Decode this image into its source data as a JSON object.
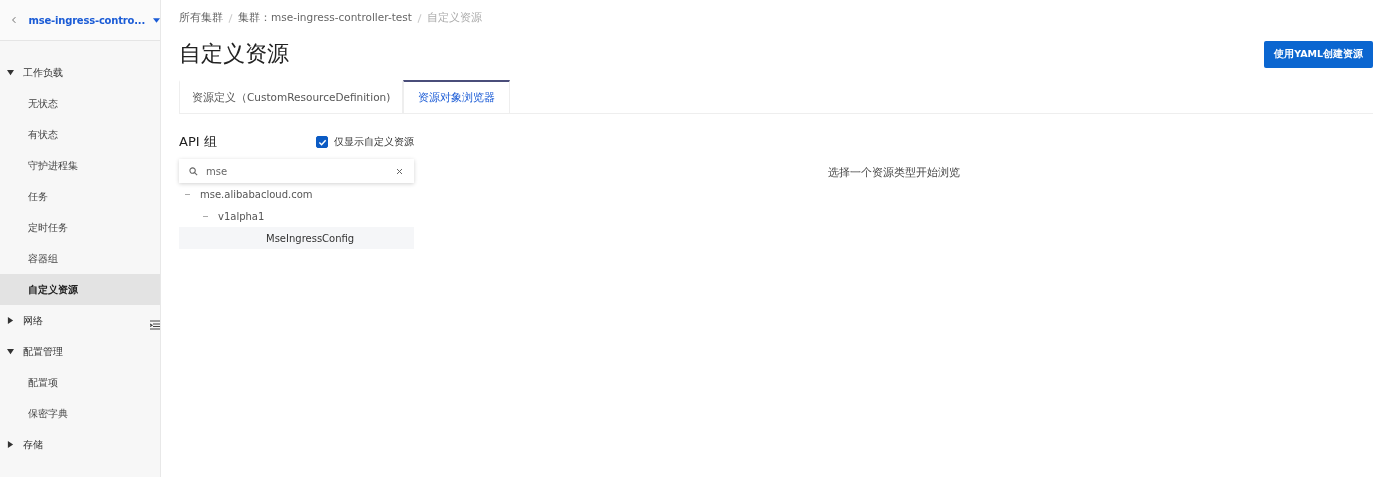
{
  "cluster_selector": {
    "label": "mse-ingress-contro..."
  },
  "sidebar": {
    "groups": [
      {
        "label": "工作负载",
        "expanded": true,
        "items": [
          {
            "label": "无状态",
            "selected": false
          },
          {
            "label": "有状态",
            "selected": false
          },
          {
            "label": "守护进程集",
            "selected": false
          },
          {
            "label": "任务",
            "selected": false
          },
          {
            "label": "定时任务",
            "selected": false
          },
          {
            "label": "容器组",
            "selected": false
          },
          {
            "label": "自定义资源",
            "selected": true
          }
        ]
      },
      {
        "label": "网络",
        "expanded": false
      },
      {
        "label": "配置管理",
        "expanded": true,
        "items": [
          {
            "label": "配置项",
            "selected": false
          },
          {
            "label": "保密字典",
            "selected": false
          }
        ]
      },
      {
        "label": "存储",
        "expanded": false
      }
    ]
  },
  "breadcrumb": [
    "所有集群",
    "集群：mse-ingress-controller-test",
    "自定义资源"
  ],
  "title": "自定义资源",
  "create_button": "使用YAML创建资源",
  "tabs": [
    {
      "label": "资源定义（CustomResourceDefinition)",
      "selected": false
    },
    {
      "label": "资源对象浏览器",
      "selected": true
    }
  ],
  "api_group": {
    "heading": "API 组",
    "custom_only": {
      "label": "仅显示自定义资源",
      "checked": true
    },
    "search": {
      "value": "mse"
    },
    "tree": [
      {
        "label": "mse.alibabacloud.com",
        "expanded": true,
        "selected": false,
        "children": [
          {
            "label": "v1alpha1",
            "expanded": true,
            "selected": false,
            "children": [
              {
                "label": "MseIngressConfig",
                "selected": true
              }
            ]
          }
        ]
      }
    ]
  },
  "empty_message": "选择一个资源类型开始浏览"
}
